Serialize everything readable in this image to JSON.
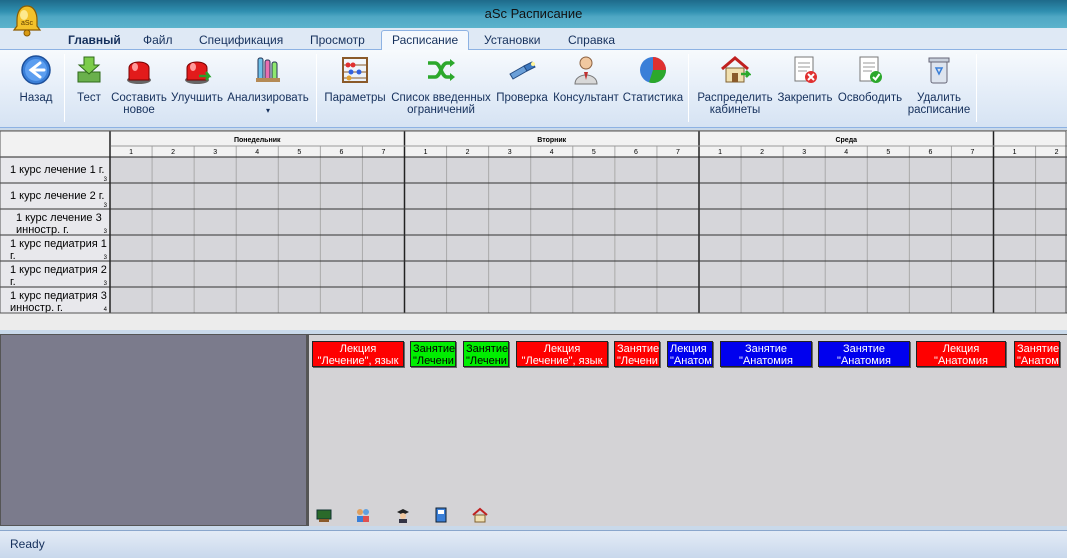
{
  "window": {
    "title": "aSc Расписание"
  },
  "tabs": [
    {
      "label": "Главный",
      "bold": true
    },
    {
      "label": "Файл"
    },
    {
      "label": "Спецификация"
    },
    {
      "label": "Просмотр"
    },
    {
      "label": "Расписание",
      "active": true
    },
    {
      "label": "Установки"
    },
    {
      "label": "Справка"
    }
  ],
  "ribbon": {
    "back": "Назад",
    "test": "Тест",
    "create_l1": "Составить",
    "create_l2": "новое",
    "improve": "Улучшить",
    "analyze": "Анализировать",
    "parameters": "Параметры",
    "constraints_l1": "Список введенных",
    "constraints_l2": "ограничений",
    "check": "Проверка",
    "consultant": "Консультант",
    "statistics": "Статистика",
    "rooms_l1": "Распределить",
    "rooms_l2": "кабинеты",
    "lock": "Закрепить",
    "free": "Освободить",
    "delete_l1": "Удалить",
    "delete_l2": "расписание"
  },
  "grid": {
    "days": [
      "Понедельник",
      "Вторник",
      "Среда"
    ],
    "periods": [
      "1",
      "2",
      "3",
      "4",
      "5",
      "6",
      "7"
    ],
    "extra_periods": [
      "1",
      "2"
    ],
    "rows": [
      {
        "l1": "1 курс лечение 1 г.",
        "l2": "",
        "sub": "3"
      },
      {
        "l1": "1 курс лечение 2 г.",
        "l2": "",
        "sub": "3"
      },
      {
        "l1": "1 курс лечение 3",
        "l2": "иннostr. г.",
        "sub": "3"
      },
      {
        "l1": "1 курс педиатрия 1",
        "l2": "г.",
        "sub": "3"
      },
      {
        "l1": "1 курс педиатрия 2",
        "l2": "г.",
        "sub": "3"
      },
      {
        "l1": "1 курс педиатрия 3",
        "l2": "инностр. г.",
        "sub": "4"
      }
    ]
  },
  "cards": [
    {
      "l1": "Лекция",
      "l2": "\"Лечение\", язык",
      "color": "#ff0000"
    },
    {
      "l1": "Занятие",
      "l2": "\"Лечени",
      "color": "#00ee00"
    },
    {
      "l1": "Занятие",
      "l2": "\"Лечени",
      "color": "#00ee00"
    },
    {
      "l1": "Лекция",
      "l2": "\"Лечение\", язык",
      "color": "#ff0000"
    },
    {
      "l1": "Занятие",
      "l2": "\"Лечени",
      "color": "#ff0000"
    },
    {
      "l1": "Лекция",
      "l2": "\"Анатом",
      "color": "#0000ee"
    },
    {
      "l1": "Занятие",
      "l2": "\"Анатомия",
      "color": "#0000ee"
    },
    {
      "l1": "Занятие",
      "l2": "\"Анатомия",
      "color": "#0000ee"
    },
    {
      "l1": "Лекция",
      "l2": "\"Анатомия",
      "color": "#ff0000"
    },
    {
      "l1": "Занятие",
      "l2": "\"Анатом",
      "color": "#ff0000"
    }
  ],
  "bottom_icons": [
    "classes-icon",
    "teachers-icon",
    "student-icon",
    "subjects-icon",
    "rooms-icon"
  ],
  "status": {
    "text": "Ready"
  },
  "colors": {
    "ribbon_text": "#15305c",
    "lecture": "#ff0000",
    "practice_green": "#00ee00",
    "practice_blue": "#0000ee"
  }
}
